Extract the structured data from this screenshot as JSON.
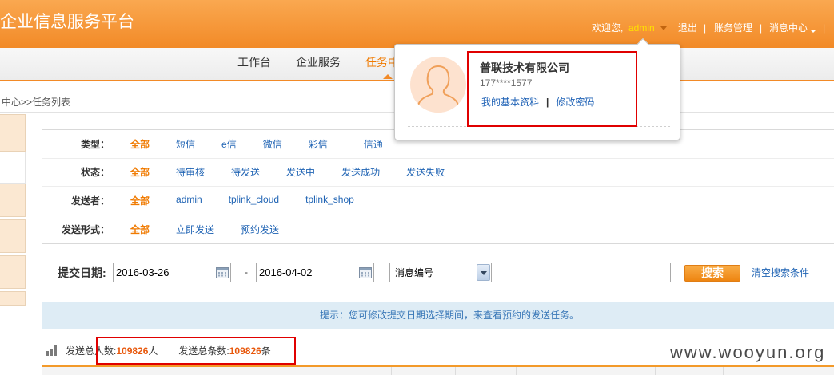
{
  "header": {
    "title": "企业信息服务平台",
    "welcome": "欢迎您,",
    "username": "admin",
    "logout": "退出",
    "billing": "账务管理",
    "messages": "消息中心",
    "separator": "|"
  },
  "nav": {
    "tabs": [
      {
        "label": "工作台"
      },
      {
        "label": "企业服务"
      },
      {
        "label": "任务中"
      }
    ],
    "active_index": 2
  },
  "breadcrumb": "中心>>任务列表",
  "filters": [
    {
      "label": "类型：",
      "options": [
        "全部",
        "短信",
        "e信",
        "微信",
        "彩信",
        "一信通"
      ],
      "selected_index": 0
    },
    {
      "label": "状态：",
      "options": [
        "全部",
        "待审核",
        "待发送",
        "发送中",
        "发送成功",
        "发送失败"
      ],
      "selected_index": 0
    },
    {
      "label": "发送者：",
      "options": [
        "全部",
        "admin",
        "tplink_cloud",
        "tplink_shop"
      ],
      "selected_index": 0
    },
    {
      "label": "发送形式：",
      "options": [
        "全部",
        "立即发送",
        "预约发送"
      ],
      "selected_index": 0
    }
  ],
  "search": {
    "date_label": "提交日期:",
    "start_date": "2016-03-26",
    "range_separator": "-",
    "end_date": "2016-04-02",
    "field_select": "消息编号",
    "keyword": "",
    "button": "搜索",
    "clear_link": "清空搜索条件"
  },
  "tip": "提示：您可修改提交日期选择期间，来查看预约的发送任务。",
  "stats": {
    "people_label": "发送总人数:",
    "people_value": "109826",
    "people_unit": "人",
    "messages_label": "发送总条数:",
    "messages_value": "109826",
    "messages_unit": "条"
  },
  "user_popup": {
    "company": "普联技术有限公司",
    "phone": "177****1577",
    "profile_link": "我的基本资料",
    "separator": "|",
    "password_link": "修改密码"
  },
  "watermark": "www.wooyun.org",
  "icons": {
    "user_menu": "caret-down-icon",
    "message_menu": "caret-down-icon",
    "date_picker": "calendar-icon",
    "select": "chevron-down-icon",
    "stats": "bar-chart-icon",
    "avatar": "user-avatar-icon"
  },
  "colors": {
    "header": "#f28a27",
    "active": "#f07a00",
    "link": "#2064b4",
    "tip_background": "#deecf5",
    "stat_number": "#e8580c",
    "annotation": "#e00000"
  }
}
